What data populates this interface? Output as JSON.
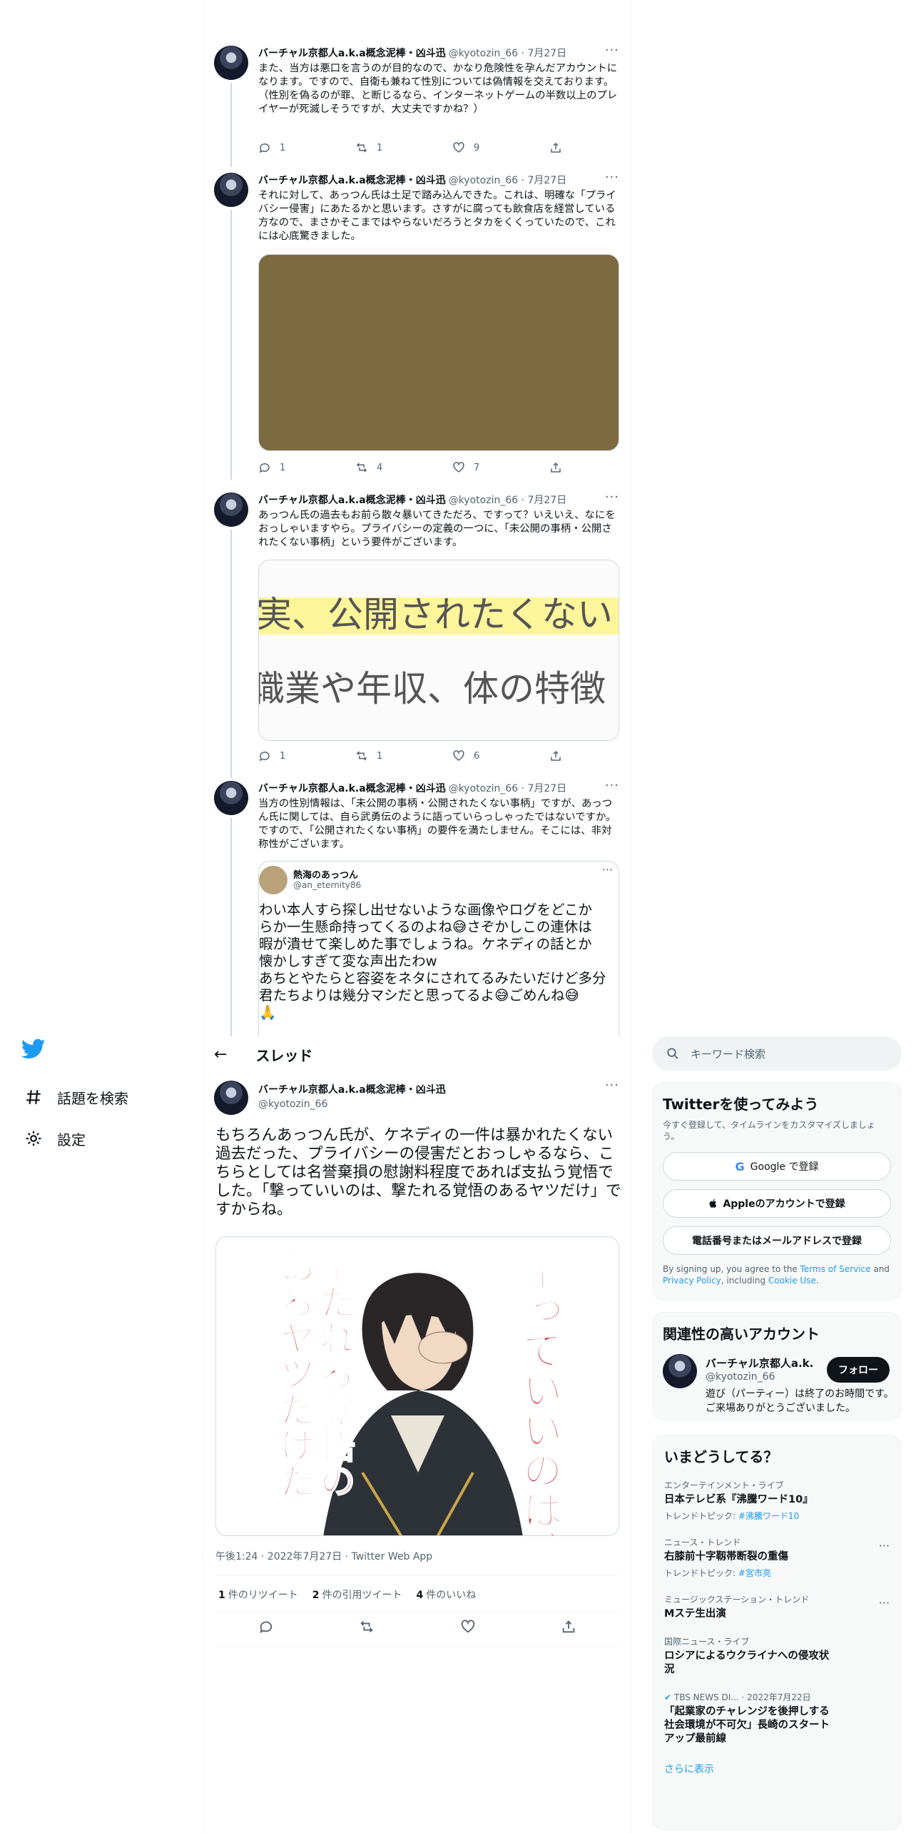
{
  "nav": {
    "items": [
      {
        "label": "話題を検索",
        "icon": "hashtag-icon"
      },
      {
        "label": "設定",
        "icon": "gear-icon"
      }
    ]
  },
  "thread": {
    "tweets": [
      {
        "name": "バーチャル京都人a.k.a概念泥棒・凶斗迅",
        "handle": "@kyotozin_66 · 7月27日",
        "text": "また、当方は悪口を言うのが目的なので、かなり危険性を孕んだアカウントになります。ですので、自衛も兼ねて性別については偽情報を交えております。\n（性別を偽るのが罪、と断じるなら、インターネットゲームの半数以上のプレイヤーが死滅しそうですが、大丈夫ですかね？）",
        "replies": "1",
        "retweets": "1",
        "likes": "9"
      },
      {
        "name": "バーチャル京都人a.k.a概念泥棒・凶斗迅",
        "handle": "@kyotozin_66 · 7月27日",
        "text": "それに対して、あっつん氏は土足で踏み込んできた。これは、明確な「プライバシー侵害」にあたるかと思います。さすがに腐っても飲食店を経営している方なので、まさかそこまではやらないだろうとタカをくくっていたので、これには心底驚きました。",
        "replies": "1",
        "retweets": "4",
        "likes": "7"
      },
      {
        "name": "バーチャル京都人a.k.a概念泥棒・凶斗迅",
        "handle": "@kyotozin_66 · 7月27日",
        "text": "あっつん氏の過去もお前ら散々暴いてきただろ、ですって？いえいえ、なにをおっしゃいますやら。プライバシーの定義の一つに、「未公開の事柄・公開されたくない事柄」という要件がございます。",
        "image_line1": "実、公開されたくない",
        "image_line2": "職業や年収、体の特徴",
        "replies": "1",
        "retweets": "1",
        "likes": "6"
      },
      {
        "name": "バーチャル京都人a.k.a概念泥棒・凶斗迅",
        "handle": "@kyotozin_66 · 7月27日",
        "text": "当方の性別情報は、「未公開の事柄・公開されたくない事柄」ですが、あっつん氏に関しては、自ら武勇伝のように語っていらっしゃったではないですか。ですので、「公開されたくない事柄」の要件を満たしません。そこには、非対称性がございます。"
      }
    ],
    "quoted": {
      "name": "熱海のあっつん",
      "handle": "@an_eternity86",
      "text": "わい本人すら探し出せないような画像やログをどこか\nらか一生懸命持ってくるのよね😅さぞかしこの連休は\n暇が潰せて楽しめた事でしょうね。ケネディの話とか\n懐かしすぎて変な声出たわw\nあちとやたらと容姿をネタにされてるみたいだけど多分\n君たちよりは幾分マシだと思ってるよ😅ごめんね😅\n🙏"
    }
  },
  "main": {
    "header_title": "スレッド",
    "name": "バーチャル京都人a.k.a概念泥棒・凶斗迅",
    "handle": "@kyotozin_66",
    "text": "もちろんあっつん氏が、ケネディの一件は暴かれたくない過去だった、プライバシーの侵害だとおっしゃるなら、こちらとしては名誉棄損の慰謝料程度であれば支払う覚悟でした。「撃っていいのは、撃たれる覚悟のあるヤツだけ」ですからね。",
    "image_text_right": "撃っていいのは、",
    "image_text_left": "撃たれる覚悟のあるヤツだけだ",
    "meta": "午後1:24 · 2022年7月27日 · Twitter Web App",
    "stats": [
      {
        "num": "1",
        "label": "件のリツイート"
      },
      {
        "num": "2",
        "label": "件の引用ツイート"
      },
      {
        "num": "4",
        "label": "件のいいね"
      }
    ]
  },
  "sidebar": {
    "search_placeholder": "キーワード検索",
    "signup": {
      "title": "Twitterを使ってみよう",
      "subtitle": "今すぐ登録して、タイムラインをカスタマイズしましょう。",
      "google": "Google で登録",
      "apple": "Appleのアカウントで登録",
      "phone": "電話番号またはメールアドレスで登録",
      "legal_1": "By signing up, you agree to the ",
      "legal_tos": "Terms of Service",
      "legal_2": " and ",
      "legal_privacy": "Privacy Policy",
      "legal_3": ", including ",
      "legal_cookie": "Cookie Use",
      "legal_4": "."
    },
    "related": {
      "title": "関連性の高いアカウント",
      "name": "バーチャル京都人a.k...",
      "handle": "@kyotozin_66",
      "follow": "フォロー",
      "bio": "遊び（パーティー）は終了のお時間です。ご来場ありがとうございました。"
    },
    "trends": {
      "title": "いまどうしてる？",
      "items": [
        {
          "cat": "エンターテインメント・ライブ",
          "title": "日本テレビ系『沸騰ワード10』",
          "sub": "トレンドトピック: ",
          "link": "#沸騰ワード10"
        },
        {
          "cat": "ニュース・トレンド",
          "title": "右膝前十字靱帯断裂の重傷",
          "sub": "トレンドトピック: ",
          "link": "#宮市亮"
        },
        {
          "cat": "ミュージックステーション・トレンド",
          "title": "Mステ生出演"
        },
        {
          "cat": "国際ニュース・ライブ",
          "title": "ロシアによるウクライナへの侵攻状況"
        },
        {
          "cat": "TBS NEWS DI... · 2022年7月22日",
          "title": "「起業家のチャレンジを後押しする社会環境が不可欠」長崎のスタートアップ最前線"
        }
      ],
      "more": "さらに表示"
    }
  },
  "colors": {
    "accent": "#1d9bf0",
    "text": "#0f1419",
    "muted": "#536471",
    "border": "#cfd9de",
    "highlight": "#fff59a",
    "brown": "#7d6a40"
  }
}
